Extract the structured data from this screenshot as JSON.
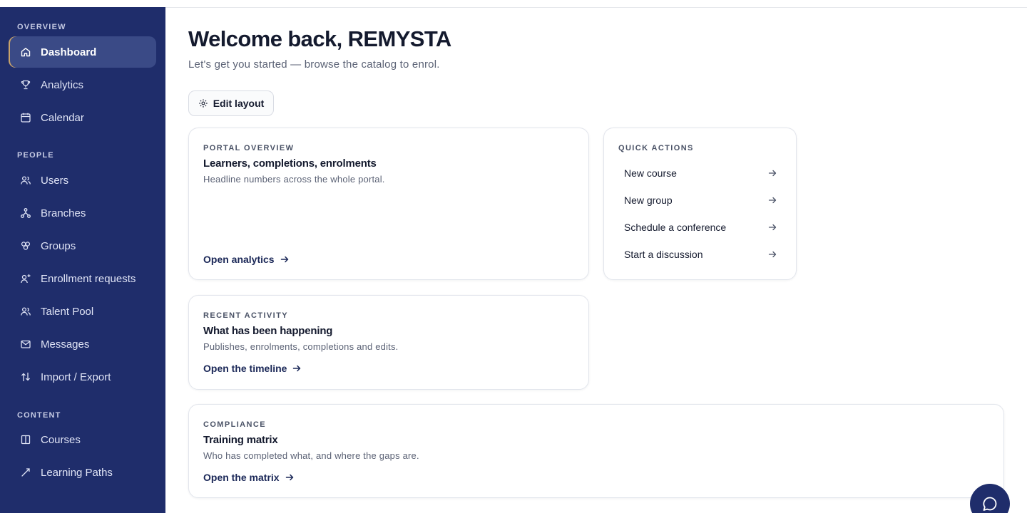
{
  "sidebar": {
    "sections": {
      "overview": "OVERVIEW",
      "people": "PEOPLE",
      "content": "CONTENT"
    },
    "items": [
      {
        "label": "Dashboard",
        "icon": "home-icon",
        "active": true
      },
      {
        "label": "Analytics",
        "icon": "trophy-icon"
      },
      {
        "label": "Calendar",
        "icon": "calendar-icon"
      },
      {
        "label": "Users",
        "icon": "users-icon"
      },
      {
        "label": "Branches",
        "icon": "branches-icon"
      },
      {
        "label": "Groups",
        "icon": "groups-icon"
      },
      {
        "label": "Enrollment requests",
        "icon": "user-plus-icon"
      },
      {
        "label": "Talent Pool",
        "icon": "talent-pool-icon"
      },
      {
        "label": "Messages",
        "icon": "mail-icon"
      },
      {
        "label": "Import / Export",
        "icon": "import-export-icon"
      },
      {
        "label": "Courses",
        "icon": "book-icon"
      },
      {
        "label": "Learning Paths",
        "icon": "path-icon"
      }
    ]
  },
  "header": {
    "title": "Welcome back, REMYSTA",
    "subtitle": "Let's get you started — browse the catalog to enrol.",
    "edit_layout": "Edit layout"
  },
  "cards": {
    "portal": {
      "eyebrow": "PORTAL OVERVIEW",
      "title": "Learners, completions, enrolments",
      "desc": "Headline numbers across the whole portal.",
      "link": "Open analytics"
    },
    "quick_actions": {
      "eyebrow": "QUICK ACTIONS",
      "items": [
        "New course",
        "New group",
        "Schedule a conference",
        "Start a discussion"
      ]
    },
    "activity": {
      "eyebrow": "RECENT ACTIVITY",
      "title": "What has been happening",
      "desc": "Publishes, enrolments, completions and edits.",
      "link": "Open the timeline"
    },
    "compliance": {
      "eyebrow": "COMPLIANCE",
      "title": "Training matrix",
      "desc": "Who has completed what, and where the gaps are.",
      "link": "Open the matrix"
    }
  },
  "chat": {
    "icon": "chat-bubble-icon"
  },
  "colors": {
    "sidebar_bg": "#1f2d6b",
    "active_item_bg": "#3a4a86",
    "active_accent": "#c9a36a"
  }
}
